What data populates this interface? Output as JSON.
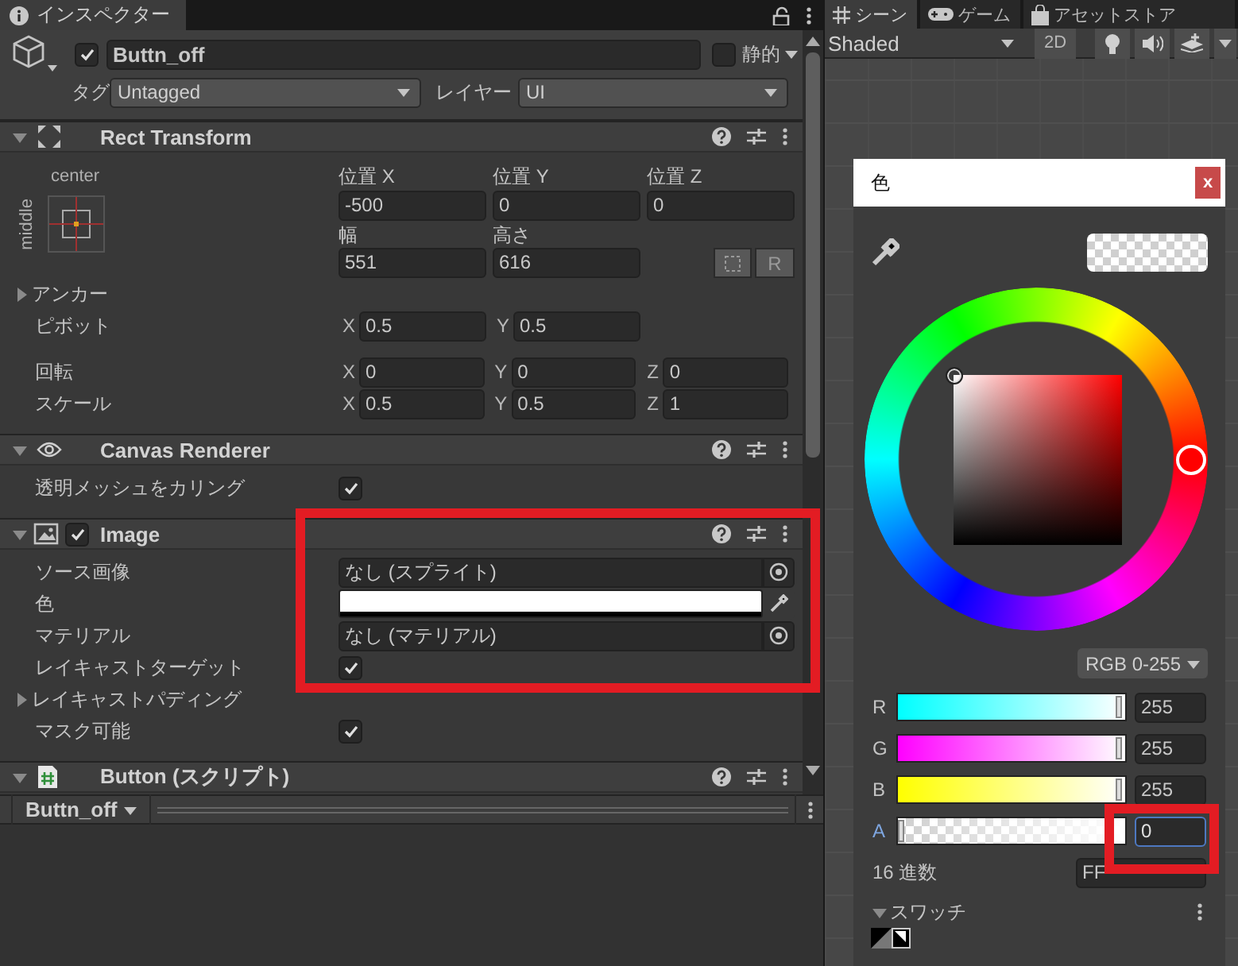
{
  "inspector": {
    "tab": {
      "label": "インスペクター",
      "selected": true
    }
  },
  "object": {
    "active": true,
    "name": "Buttn_off",
    "static": false,
    "static_label": "静的",
    "tag_label": "タグ",
    "tag": "Untagged",
    "layer_label": "レイヤー",
    "layer": "UI"
  },
  "rect_transform": {
    "title": "Rect Transform",
    "expanded": true,
    "anchor_h": "center",
    "anchor_v": "middle",
    "position": [
      {
        "label": "位置 X",
        "value": "-500"
      },
      {
        "label": "位置 Y",
        "value": "0"
      },
      {
        "label": "位置 Z",
        "value": "0"
      }
    ],
    "size": [
      {
        "label": "幅",
        "value": "551"
      },
      {
        "label": "高さ",
        "value": "616"
      }
    ],
    "raw_button": "R",
    "anchors": {
      "label": "アンカー",
      "expanded": false
    },
    "rows": [
      {
        "label": "ピボット",
        "fields": [
          {
            "axis": "X",
            "value": "0.5"
          },
          {
            "axis": "Y",
            "value": "0.5"
          }
        ]
      },
      {
        "label": "回転",
        "fields": [
          {
            "axis": "X",
            "value": "0"
          },
          {
            "axis": "Y",
            "value": "0"
          },
          {
            "axis": "Z",
            "value": "0"
          }
        ]
      },
      {
        "label": "スケール",
        "fields": [
          {
            "axis": "X",
            "value": "0.5"
          },
          {
            "axis": "Y",
            "value": "0.5"
          },
          {
            "axis": "Z",
            "value": "1"
          }
        ]
      }
    ]
  },
  "components": [
    {
      "kind": "canvas_renderer",
      "title": "Canvas Renderer",
      "expanded": true,
      "props": [
        {
          "kind": "toggle",
          "label": "透明メッシュをカリング",
          "checked": true
        }
      ]
    },
    {
      "kind": "image",
      "title": "Image",
      "enabled": true,
      "expanded": true,
      "props": [
        {
          "kind": "object",
          "label": "ソース画像",
          "value": "なし (スプライト)"
        },
        {
          "kind": "color",
          "label": "色",
          "color": "#ffffff",
          "level": 0
        },
        {
          "kind": "object",
          "label": "マテリアル",
          "value": "なし (マテリアル)"
        },
        {
          "kind": "toggle",
          "label": "レイキャストターゲット",
          "checked": true
        },
        {
          "kind": "foldout",
          "label": "レイキャストパディング",
          "expanded": false
        },
        {
          "kind": "toggle",
          "label": "マスク可能",
          "checked": true
        }
      ]
    },
    {
      "kind": "script",
      "title": "Button (スクリプト)",
      "expanded": true
    }
  ],
  "bottom_bar": {
    "name": "Buttn_off"
  },
  "scene": {
    "tabs": [
      {
        "kind": "scene",
        "label": "シーン",
        "selected": true
      },
      {
        "kind": "game",
        "label": "ゲーム",
        "selected": false
      },
      {
        "kind": "store",
        "label": "アセットストア",
        "selected": false
      }
    ],
    "shading": "Shaded",
    "mode_2d": "2D"
  },
  "color_picker": {
    "title": "色",
    "close": "x",
    "mode": "RGB 0-255",
    "channels": [
      {
        "name": "R",
        "level": 1,
        "value": "255",
        "focused": false
      },
      {
        "name": "G",
        "level": 1,
        "value": "255",
        "focused": false
      },
      {
        "name": "B",
        "level": 1,
        "value": "255",
        "focused": false
      },
      {
        "name": "A",
        "level": 0,
        "value": "0",
        "focused": true
      }
    ],
    "hex_label": "16 進数",
    "hex": "FF",
    "swatches": {
      "label": "スワッチ",
      "expanded": true
    }
  }
}
